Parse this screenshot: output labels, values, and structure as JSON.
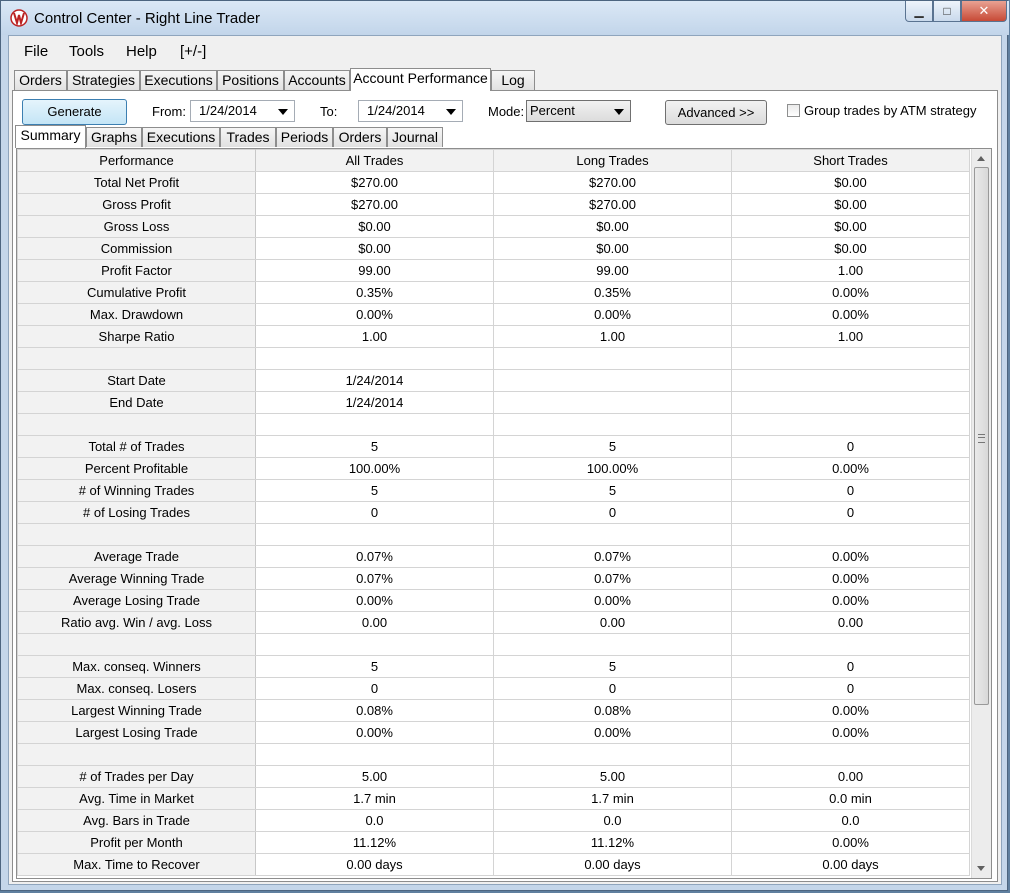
{
  "window": {
    "title": "Control Center - Right Line Trader",
    "minimize": "▁",
    "maximize": "□",
    "close": "✕"
  },
  "menu": [
    "File",
    "Tools",
    "Help",
    "[+/-]"
  ],
  "top_tabs": [
    "Orders",
    "Strategies",
    "Executions",
    "Positions",
    "Accounts",
    "Account Performance",
    "Log"
  ],
  "top_tabs_active": "Account Performance",
  "toolbar": {
    "generate_label": "Generate",
    "from_label": "From:",
    "from_value": "1/24/2014",
    "to_label": "To:",
    "to_value": "1/24/2014",
    "mode_label": "Mode:",
    "mode_value": "Percent",
    "advanced_label": "Advanced >>",
    "group_label": "Group trades by ATM strategy",
    "group_checked": false
  },
  "sub_tabs": [
    "Summary",
    "Graphs",
    "Executions",
    "Trades",
    "Periods",
    "Orders",
    "Journal"
  ],
  "sub_tabs_active": "Summary",
  "table": {
    "columns": [
      "Performance",
      "All Trades",
      "Long Trades",
      "Short Trades"
    ],
    "rows": [
      [
        "Total Net Profit",
        "$270.00",
        "$270.00",
        "$0.00"
      ],
      [
        "Gross Profit",
        "$270.00",
        "$270.00",
        "$0.00"
      ],
      [
        "Gross Loss",
        "$0.00",
        "$0.00",
        "$0.00"
      ],
      [
        "Commission",
        "$0.00",
        "$0.00",
        "$0.00"
      ],
      [
        "Profit Factor",
        "99.00",
        "99.00",
        "1.00"
      ],
      [
        "Cumulative Profit",
        "0.35%",
        "0.35%",
        "0.00%"
      ],
      [
        "Max. Drawdown",
        "0.00%",
        "0.00%",
        "0.00%"
      ],
      [
        "Sharpe Ratio",
        "1.00",
        "1.00",
        "1.00"
      ],
      [
        "",
        "",
        "",
        ""
      ],
      [
        "Start Date",
        "1/24/2014",
        "",
        ""
      ],
      [
        "End Date",
        "1/24/2014",
        "",
        ""
      ],
      [
        "",
        "",
        "",
        ""
      ],
      [
        "Total # of Trades",
        "5",
        "5",
        "0"
      ],
      [
        "Percent Profitable",
        "100.00%",
        "100.00%",
        "0.00%"
      ],
      [
        "# of Winning Trades",
        "5",
        "5",
        "0"
      ],
      [
        "# of Losing Trades",
        "0",
        "0",
        "0"
      ],
      [
        "",
        "",
        "",
        ""
      ],
      [
        "Average Trade",
        "0.07%",
        "0.07%",
        "0.00%"
      ],
      [
        "Average Winning Trade",
        "0.07%",
        "0.07%",
        "0.00%"
      ],
      [
        "Average Losing Trade",
        "0.00%",
        "0.00%",
        "0.00%"
      ],
      [
        "Ratio avg. Win / avg. Loss",
        "0.00",
        "0.00",
        "0.00"
      ],
      [
        "",
        "",
        "",
        ""
      ],
      [
        "Max. conseq. Winners",
        "5",
        "5",
        "0"
      ],
      [
        "Max. conseq. Losers",
        "0",
        "0",
        "0"
      ],
      [
        "Largest Winning Trade",
        "0.08%",
        "0.08%",
        "0.00%"
      ],
      [
        "Largest Losing Trade",
        "0.00%",
        "0.00%",
        "0.00%"
      ],
      [
        "",
        "",
        "",
        ""
      ],
      [
        "# of Trades per Day",
        "5.00",
        "5.00",
        "0.00"
      ],
      [
        "Avg. Time in Market",
        "1.7 min",
        "1.7 min",
        "0.0 min"
      ],
      [
        "Avg. Bars in Trade",
        "0.0",
        "0.0",
        "0.0"
      ],
      [
        "Profit per Month",
        "11.12%",
        "11.12%",
        "0.00%"
      ],
      [
        "Max. Time to Recover",
        "0.00 days",
        "0.00 days",
        "0.00 days"
      ]
    ]
  },
  "colors": {
    "title_bar": "#c2d5ea",
    "grid_header": "#f2f2f2",
    "close_button": "#c74a36"
  }
}
